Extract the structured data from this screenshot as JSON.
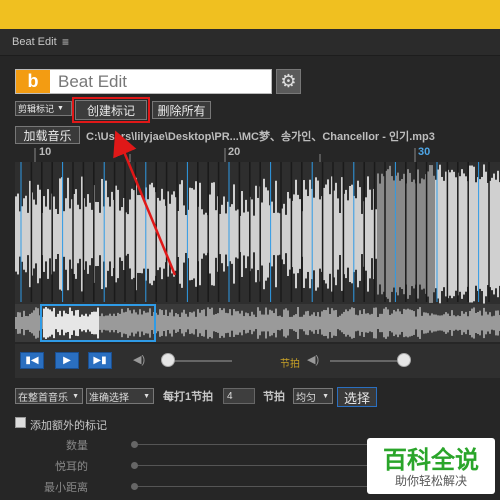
{
  "app": {
    "panel_title": "Beat Edit",
    "menu_icon": "hamburger-icon",
    "logo_letter": "b",
    "logo_text": "Beat Edit",
    "accent": "#f39c12"
  },
  "toolbar": {
    "edit_select": "剪辑标记",
    "create_marker": "创建标记",
    "delete_all": "删除所有",
    "load_music": "加载音乐",
    "file_path": "C:\\Users\\lilyjae\\Desktop\\PR...\\MC梦、송가인、Chancellor - 인기.mp3"
  },
  "ruler": {
    "labels": [
      "10",
      "20",
      "30"
    ]
  },
  "transport": {
    "volume_level": 0.08,
    "beat_label": "节拍",
    "beat_volume_level": 0.93
  },
  "options": {
    "scope_select": "在整首音乐",
    "mode_select": "准确选择",
    "every_label": "每打1节拍",
    "beats_value": "4",
    "beat_label": "节拍",
    "align_select": "均匀",
    "select_button": "选择"
  },
  "extra": {
    "checkbox_label": "添加额外的标记",
    "rows": [
      "数量",
      "悦耳的",
      "最小距离"
    ]
  },
  "watermark": {
    "title": "百科全说",
    "subtitle": "助你轻松解决"
  }
}
